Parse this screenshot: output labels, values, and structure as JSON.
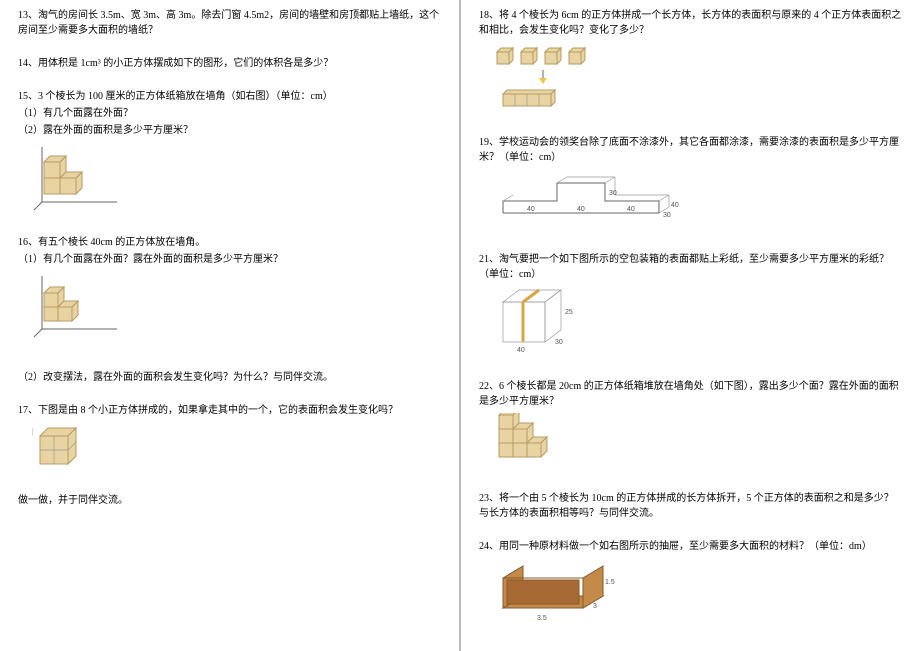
{
  "left": {
    "q13": "13、淘气的房间长 3.5m、宽 3m、高 3m。除去门窗 4.5m2，房间的墙壁和房顶都贴上墙纸，这个房间至少需要多大面积的墙纸？",
    "q14": "14、用体积是 1cm³ 的小正方体摆成如下的图形，它们的体积各是多少？",
    "q15a": "15、3 个棱长为 100 厘米的正方体纸箱放在墙角（如右图）（单位：cm）",
    "q15b": "（1）有几个面露在外面？",
    "q15c": "（2）露在外面的面积是多少平方厘米？",
    "q16a": "16、有五个棱长 40cm 的正方体放在墙角。",
    "q16b": "（1）有几个面露在外面？露在外面的面积是多少平方厘米？",
    "q16c": "（2）改变摆法，露在外面的面积会发生变化吗？为什么？与同伴交流。",
    "q17a": "17、下图是由 8 个小正方体拼成的，如果拿走其中的一个，它的表面积会发生变化吗？",
    "q17b": "做一做，并于同伴交流。"
  },
  "right": {
    "q18": "18、将 4 个棱长为 6cm 的正方体拼成一个长方体，长方体的表面积与原来的 4 个正方体表面积之和相比，会发生变化吗？变化了多少？",
    "q19": "19、学校运动会的领奖台除了底面不涂漆外，其它各面都涂漆，需要涂漆的表面积是多少平方厘米？（单位：cm）",
    "q21": "21、淘气要把一个如下图所示的空包装箱的表面都贴上彩纸，至少需要多少平方厘米的彩纸？（单位：cm）",
    "q22": "22、6 个棱长都是 20cm 的正方体纸箱堆放在墙角处（如下图），露出多少个面？露在外面的面积是多少平方厘米？",
    "q23": "23、将一个由 5 个棱长为 10cm 的正方体拼成的长方体拆开，5 个正方体的表面积之和是多少？与长方体的表面积相等吗？与同伴交流。",
    "q24": "24、用同一种原材料做一个如右图所示的抽屉，至少需要多大面积的材料？（单位：dm）"
  },
  "labels": {
    "p19": {
      "a": "40",
      "b": "40",
      "c": "40",
      "d": "40",
      "e": "30",
      "f": "30"
    },
    "p21": {
      "a": "40",
      "b": "30",
      "c": "25"
    },
    "p24": {
      "a": "1.5",
      "b": "3",
      "c": "3.5"
    }
  }
}
